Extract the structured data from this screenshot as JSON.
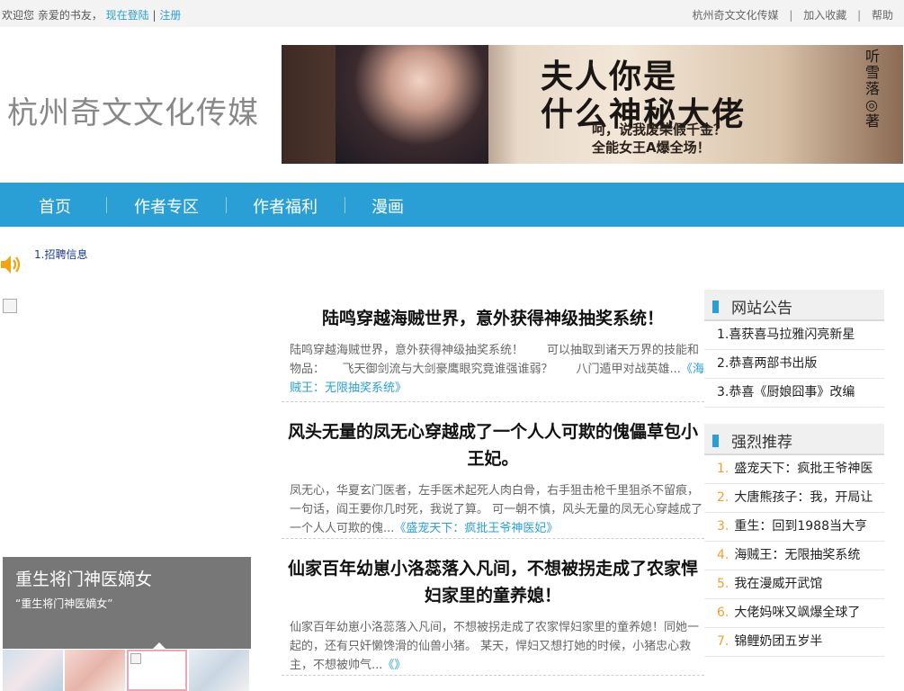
{
  "topbar": {
    "welcome": "欢迎您 亲爱的书友，",
    "login": "现在登陆",
    "separator": "|",
    "register": "注册",
    "links": [
      "杭州奇文文化传媒",
      "加入收藏",
      "帮助"
    ]
  },
  "header": {
    "logo": "杭州奇文文化传媒",
    "banner": {
      "title_line1": "夫人你是",
      "title_line2": "什么神秘大佬",
      "subtitle_line1": "呵，说我废柴假千金？",
      "subtitle_line2": "全能女王A爆全场！",
      "author": "听雪落◎著"
    }
  },
  "nav": {
    "items": [
      "首页",
      "作者专区",
      "作者福利",
      "漫画"
    ]
  },
  "notice": {
    "icon": "speaker-icon",
    "text": "1.招聘信息"
  },
  "gallery": {
    "feature_title": "重生将门神医嫡女",
    "feature_subtitle": "“重生将门神医嫡女”"
  },
  "articles": [
    {
      "title": "陆鸣穿越海贼世界，意外获得神级抽奖系统！",
      "body": "陆鸣穿越海贼世界，意外获得神级抽奖系统！　　可以抽取到诸天万界的技能和物品：　　飞天御剑流与大剑豪鹰眼究竟谁强谁弱？　　八门遁甲对战英雄...",
      "book": "《海贼王：无限抽奖系统》"
    },
    {
      "title": "风头无量的凤无心穿越成了一个人人可欺的傀儡草包小王妃。",
      "body": "凤无心，华夏玄门医者，左手医术起死人肉白骨，右手狙击枪千里狙杀不留痕，一句话，阎王要你几时死，我说了算。 可一朝不慎，风头无量的凤无心穿越成了一个人人可欺的傀...",
      "book": "《盛宠天下：疯批王爷神医妃》"
    },
    {
      "title": "仙家百年幼崽小洛蕊落入凡间，不想被拐走成了农家悍妇家里的童养媳！",
      "body": "仙家百年幼崽小洛蕊落入凡间，不想被拐走成了农家悍妇家里的童养媳！同她一起的，还有只奸懒馋滑的仙兽小猪。 某天，悍妇又想打她的时候，小猪忠心救主，不想被帅气...",
      "book": "《》"
    }
  ],
  "announcements": {
    "title": "网站公告",
    "items": [
      "1.喜获喜马拉雅闪亮新星",
      "2.恭喜两部书出版",
      "3.恭喜《厨娘囧事》改编"
    ]
  },
  "recommend": {
    "title": "强烈推荐",
    "items": [
      {
        "num": "1.",
        "name": "盛宠天下：疯批王爷神医"
      },
      {
        "num": "2.",
        "name": "大唐熊孩子：我，开局让"
      },
      {
        "num": "3.",
        "name": "重生：回到1988当大亨"
      },
      {
        "num": "4.",
        "name": "海贼王：无限抽奖系统"
      },
      {
        "num": "5.",
        "name": "我在漫威开武馆"
      },
      {
        "num": "6.",
        "name": "大佬妈咪又飒爆全球了"
      },
      {
        "num": "7.",
        "name": "锦鲤奶团五岁半"
      }
    ]
  },
  "colors": {
    "accent": "#2a9fd6",
    "rank_number": "#f0a030"
  }
}
